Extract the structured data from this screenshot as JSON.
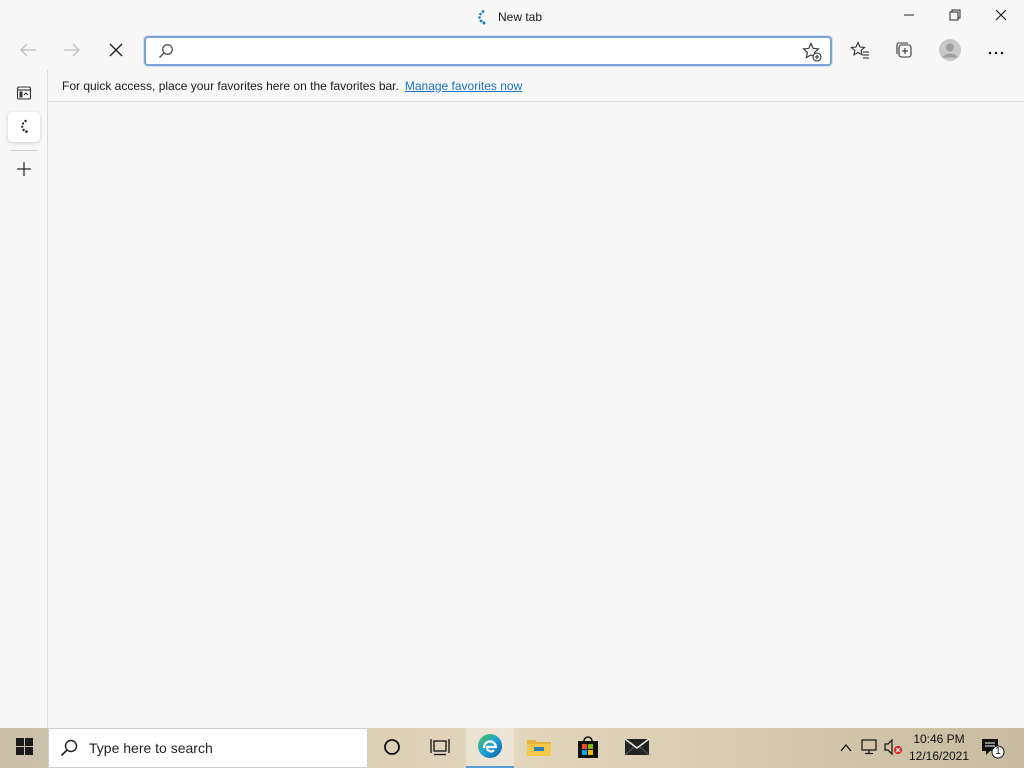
{
  "window": {
    "tab_title": "New tab"
  },
  "toolbar": {
    "address_placeholder": "",
    "address_value": ""
  },
  "favorites_bar": {
    "message": "For quick access, place your favorites here on the favorites bar.",
    "link": "Manage favorites now"
  },
  "taskbar": {
    "search_placeholder": "Type here to search",
    "time": "10:46 PM",
    "date": "12/16/2021",
    "notification_count": "1"
  },
  "icons": {
    "back": "arrow-left-icon",
    "forward": "arrow-right-icon",
    "stop": "close-icon",
    "search": "search-icon",
    "add_favorite": "star-plus-icon",
    "favorites": "favorites-icon",
    "collections": "collections-icon",
    "profile": "avatar-icon",
    "more": "ellipsis-icon"
  },
  "colors": {
    "accent": "#1a6fbf",
    "address_border": "#7ba3d6",
    "edge_blue": "#0c59a4",
    "edge_green": "#4fc24e"
  }
}
